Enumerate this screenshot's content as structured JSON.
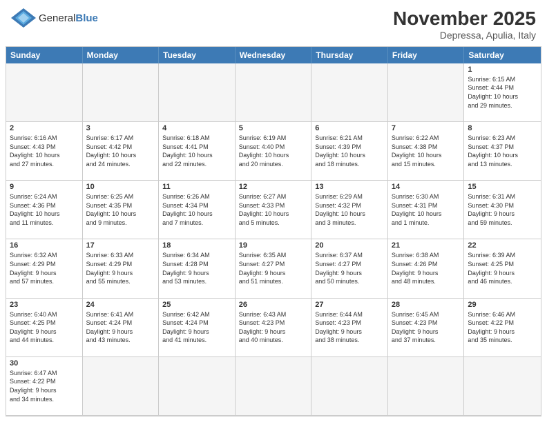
{
  "header": {
    "logo_general": "General",
    "logo_blue": "Blue",
    "month_title": "November 2025",
    "location": "Depressa, Apulia, Italy"
  },
  "weekdays": [
    "Sunday",
    "Monday",
    "Tuesday",
    "Wednesday",
    "Thursday",
    "Friday",
    "Saturday"
  ],
  "cells": [
    {
      "day": "",
      "info": "",
      "empty": true
    },
    {
      "day": "",
      "info": "",
      "empty": true
    },
    {
      "day": "",
      "info": "",
      "empty": true
    },
    {
      "day": "",
      "info": "",
      "empty": true
    },
    {
      "day": "",
      "info": "",
      "empty": true
    },
    {
      "day": "",
      "info": "",
      "empty": true
    },
    {
      "day": "1",
      "info": "Sunrise: 6:15 AM\nSunset: 4:44 PM\nDaylight: 10 hours\nand 29 minutes."
    },
    {
      "day": "2",
      "info": "Sunrise: 6:16 AM\nSunset: 4:43 PM\nDaylight: 10 hours\nand 27 minutes."
    },
    {
      "day": "3",
      "info": "Sunrise: 6:17 AM\nSunset: 4:42 PM\nDaylight: 10 hours\nand 24 minutes."
    },
    {
      "day": "4",
      "info": "Sunrise: 6:18 AM\nSunset: 4:41 PM\nDaylight: 10 hours\nand 22 minutes."
    },
    {
      "day": "5",
      "info": "Sunrise: 6:19 AM\nSunset: 4:40 PM\nDaylight: 10 hours\nand 20 minutes."
    },
    {
      "day": "6",
      "info": "Sunrise: 6:21 AM\nSunset: 4:39 PM\nDaylight: 10 hours\nand 18 minutes."
    },
    {
      "day": "7",
      "info": "Sunrise: 6:22 AM\nSunset: 4:38 PM\nDaylight: 10 hours\nand 15 minutes."
    },
    {
      "day": "8",
      "info": "Sunrise: 6:23 AM\nSunset: 4:37 PM\nDaylight: 10 hours\nand 13 minutes."
    },
    {
      "day": "9",
      "info": "Sunrise: 6:24 AM\nSunset: 4:36 PM\nDaylight: 10 hours\nand 11 minutes."
    },
    {
      "day": "10",
      "info": "Sunrise: 6:25 AM\nSunset: 4:35 PM\nDaylight: 10 hours\nand 9 minutes."
    },
    {
      "day": "11",
      "info": "Sunrise: 6:26 AM\nSunset: 4:34 PM\nDaylight: 10 hours\nand 7 minutes."
    },
    {
      "day": "12",
      "info": "Sunrise: 6:27 AM\nSunset: 4:33 PM\nDaylight: 10 hours\nand 5 minutes."
    },
    {
      "day": "13",
      "info": "Sunrise: 6:29 AM\nSunset: 4:32 PM\nDaylight: 10 hours\nand 3 minutes."
    },
    {
      "day": "14",
      "info": "Sunrise: 6:30 AM\nSunset: 4:31 PM\nDaylight: 10 hours\nand 1 minute."
    },
    {
      "day": "15",
      "info": "Sunrise: 6:31 AM\nSunset: 4:30 PM\nDaylight: 9 hours\nand 59 minutes."
    },
    {
      "day": "16",
      "info": "Sunrise: 6:32 AM\nSunset: 4:29 PM\nDaylight: 9 hours\nand 57 minutes."
    },
    {
      "day": "17",
      "info": "Sunrise: 6:33 AM\nSunset: 4:29 PM\nDaylight: 9 hours\nand 55 minutes."
    },
    {
      "day": "18",
      "info": "Sunrise: 6:34 AM\nSunset: 4:28 PM\nDaylight: 9 hours\nand 53 minutes."
    },
    {
      "day": "19",
      "info": "Sunrise: 6:35 AM\nSunset: 4:27 PM\nDaylight: 9 hours\nand 51 minutes."
    },
    {
      "day": "20",
      "info": "Sunrise: 6:37 AM\nSunset: 4:27 PM\nDaylight: 9 hours\nand 50 minutes."
    },
    {
      "day": "21",
      "info": "Sunrise: 6:38 AM\nSunset: 4:26 PM\nDaylight: 9 hours\nand 48 minutes."
    },
    {
      "day": "22",
      "info": "Sunrise: 6:39 AM\nSunset: 4:25 PM\nDaylight: 9 hours\nand 46 minutes."
    },
    {
      "day": "23",
      "info": "Sunrise: 6:40 AM\nSunset: 4:25 PM\nDaylight: 9 hours\nand 44 minutes."
    },
    {
      "day": "24",
      "info": "Sunrise: 6:41 AM\nSunset: 4:24 PM\nDaylight: 9 hours\nand 43 minutes."
    },
    {
      "day": "25",
      "info": "Sunrise: 6:42 AM\nSunset: 4:24 PM\nDaylight: 9 hours\nand 41 minutes."
    },
    {
      "day": "26",
      "info": "Sunrise: 6:43 AM\nSunset: 4:23 PM\nDaylight: 9 hours\nand 40 minutes."
    },
    {
      "day": "27",
      "info": "Sunrise: 6:44 AM\nSunset: 4:23 PM\nDaylight: 9 hours\nand 38 minutes."
    },
    {
      "day": "28",
      "info": "Sunrise: 6:45 AM\nSunset: 4:23 PM\nDaylight: 9 hours\nand 37 minutes."
    },
    {
      "day": "29",
      "info": "Sunrise: 6:46 AM\nSunset: 4:22 PM\nDaylight: 9 hours\nand 35 minutes."
    },
    {
      "day": "30",
      "info": "Sunrise: 6:47 AM\nSunset: 4:22 PM\nDaylight: 9 hours\nand 34 minutes."
    },
    {
      "day": "",
      "info": "",
      "empty": true
    },
    {
      "day": "",
      "info": "",
      "empty": true
    },
    {
      "day": "",
      "info": "",
      "empty": true
    },
    {
      "day": "",
      "info": "",
      "empty": true
    },
    {
      "day": "",
      "info": "",
      "empty": true
    },
    {
      "day": "",
      "info": "",
      "empty": true
    }
  ]
}
